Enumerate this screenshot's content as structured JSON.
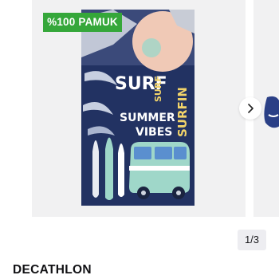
{
  "product": {
    "badge": "%100 PAMUK",
    "brand": "DECATHLON",
    "image_alt": "Surf Summer Vibes beach towel"
  },
  "carousel": {
    "page_indicator": "1/3",
    "next_icon": "chevron-right-icon"
  },
  "towel_print": {
    "big": "SURF",
    "small1": "SURF",
    "summer": "SUMMER",
    "vibes": "VIBES",
    "side": "SURFIN"
  },
  "colors": {
    "badge": "#35a73a",
    "towel_navy": "#223262",
    "mint": "#9fd7c9"
  }
}
